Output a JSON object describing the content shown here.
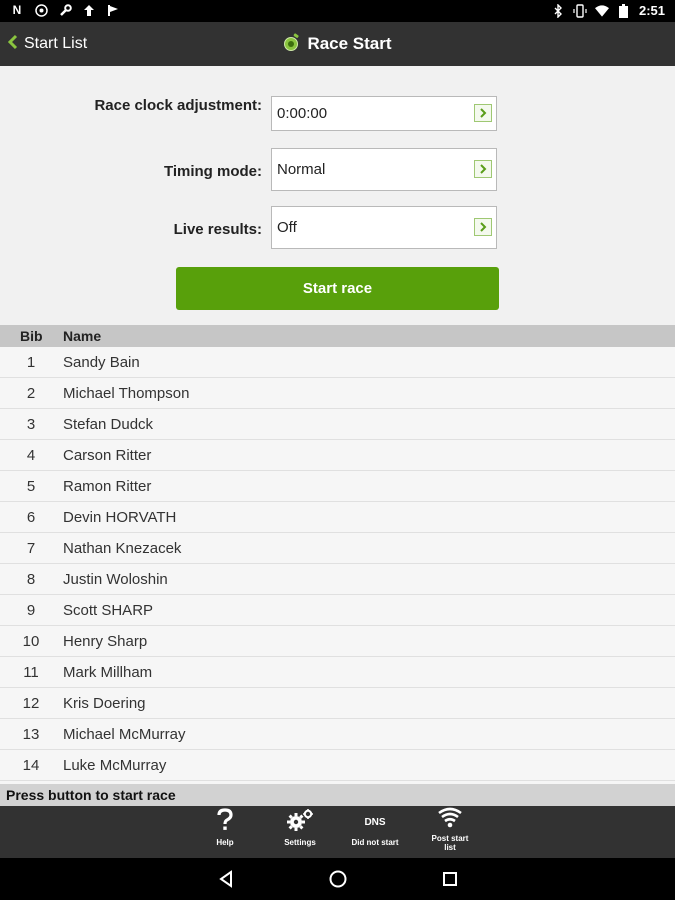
{
  "statusbar": {
    "notification_icons": [
      "n-icon",
      "copyright-icon",
      "wrench-icon",
      "upload-arrow-icon",
      "flag-icon"
    ],
    "time": "2:51"
  },
  "appbar": {
    "back_label": "Start List",
    "title": "Race Start"
  },
  "form": {
    "race_clock_label": "Race clock adjustment:",
    "race_clock_value": "0:00:00",
    "timing_mode_label": "Timing mode:",
    "timing_mode_value": "Normal",
    "live_results_label": "Live results:",
    "live_results_value": "Off",
    "start_button": "Start race"
  },
  "table": {
    "headers": {
      "bib": "Bib",
      "name": "Name"
    },
    "rows": [
      {
        "bib": "1",
        "name": "Sandy Bain"
      },
      {
        "bib": "2",
        "name": "Michael Thompson"
      },
      {
        "bib": "3",
        "name": "Stefan Dudck"
      },
      {
        "bib": "4",
        "name": "Carson Ritter"
      },
      {
        "bib": "5",
        "name": "Ramon Ritter"
      },
      {
        "bib": "6",
        "name": "Devin HORVATH"
      },
      {
        "bib": "7",
        "name": "Nathan Knezacek"
      },
      {
        "bib": "8",
        "name": "Justin Woloshin"
      },
      {
        "bib": "9",
        "name": "Scott SHARP"
      },
      {
        "bib": "10",
        "name": "Henry Sharp"
      },
      {
        "bib": "11",
        "name": "Mark Millham"
      },
      {
        "bib": "12",
        "name": "Kris Doering"
      },
      {
        "bib": "13",
        "name": "Michael McMurray"
      },
      {
        "bib": "14",
        "name": "Luke McMurray"
      }
    ]
  },
  "status_message": "Press button to start race",
  "toolbar": {
    "items": [
      {
        "label": "Help",
        "icon": "question-icon"
      },
      {
        "label": "Settings",
        "icon": "gears-icon"
      },
      {
        "label": "Did not start",
        "icon": "dns-icon",
        "icon_text": "DNS"
      },
      {
        "label": "Post start list",
        "icon": "wifi-signal-icon"
      }
    ]
  },
  "colors": {
    "accent_green": "#58a00b",
    "appbar": "#323232",
    "chevron_green": "#8ac43f"
  }
}
